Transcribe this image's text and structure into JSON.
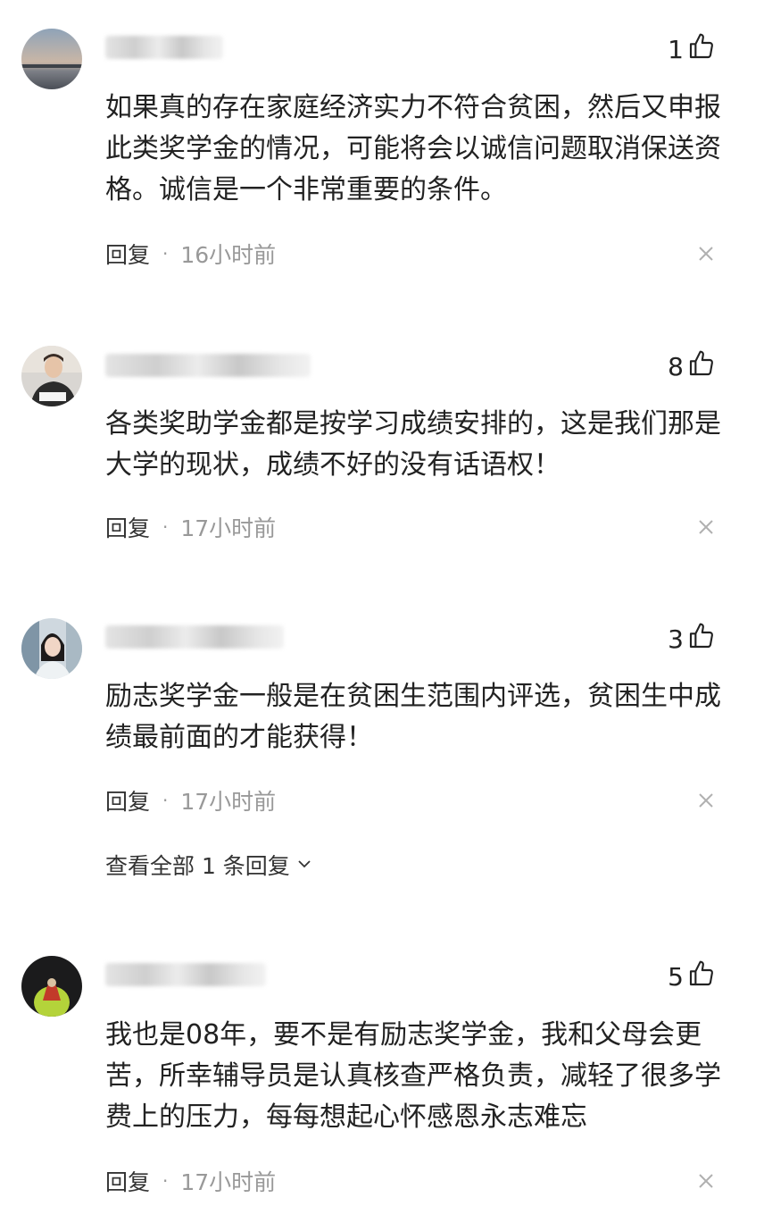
{
  "comments": [
    {
      "likes": "1",
      "text": "如果真的存在家庭经济实力不符合贫困，然后又申报此类奖学金的情况，可能将会以诚信问题取消保送资格。诚信是一个非常重要的条件。",
      "reply_label": "回复",
      "separator": "·",
      "time": "16小时前"
    },
    {
      "likes": "8",
      "text": "各类奖助学金都是按学习成绩安排的，这是我们那是大学的现状，成绩不好的没有话语权！",
      "reply_label": "回复",
      "separator": "·",
      "time": "17小时前"
    },
    {
      "likes": "3",
      "text": "励志奖学金一般是在贫困生范围内评选，贫困生中成绩最前面的才能获得！",
      "reply_label": "回复",
      "separator": "·",
      "time": "17小时前",
      "view_all": "查看全部 1 条回复"
    },
    {
      "likes": "5",
      "text": "我也是08年，要不是有励志奖学金，我和父母会更苦，所幸辅导员是认真核查严格负责，减轻了很多学费上的压力，每每想起心怀感恩永志难忘",
      "reply_label": "回复",
      "separator": "·",
      "time": "17小时前"
    }
  ],
  "icons": {
    "like": "thumbs-up-icon",
    "close": "close-icon",
    "expand": "chevron-down-icon"
  }
}
